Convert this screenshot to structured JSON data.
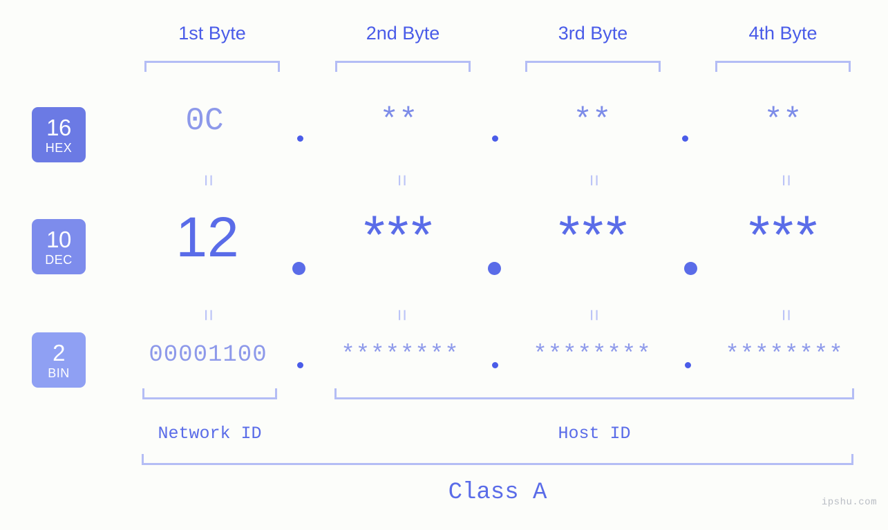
{
  "page": {
    "background_color": "#fcfdfa",
    "accent_dark": "#4a5ce8",
    "accent_mid": "#5a6ce8",
    "accent_light": "#8d99ea",
    "accent_pale": "#b4bdf5",
    "watermark": "ipshu.com"
  },
  "byte_headers": [
    {
      "label": "1st Byte"
    },
    {
      "label": "2nd Byte"
    },
    {
      "label": "3rd Byte"
    },
    {
      "label": "4th Byte"
    }
  ],
  "bases": [
    {
      "num": "16",
      "name": "HEX",
      "color": "#6b7ae4"
    },
    {
      "num": "10",
      "name": "DEC",
      "color": "#7d8cec"
    },
    {
      "num": "2",
      "name": "BIN",
      "color": "#8fa0f3"
    }
  ],
  "rows": {
    "hex": {
      "base_num": "16",
      "base_name": "HEX",
      "values": [
        "0C",
        "**",
        "**",
        "**"
      ],
      "separator": "."
    },
    "dec": {
      "base_num": "10",
      "base_name": "DEC",
      "values": [
        "12",
        "***",
        "***",
        "***"
      ],
      "separator": "."
    },
    "bin": {
      "base_num": "2",
      "base_name": "BIN",
      "values": [
        "00001100",
        "********",
        "********",
        "********"
      ],
      "separator": "."
    }
  },
  "equals_marks": {
    "symbol": "=",
    "count_per_row": 4,
    "rows": 2
  },
  "id_labels": {
    "network": "Network ID",
    "host": "Host ID"
  },
  "class_label": "Class A"
}
